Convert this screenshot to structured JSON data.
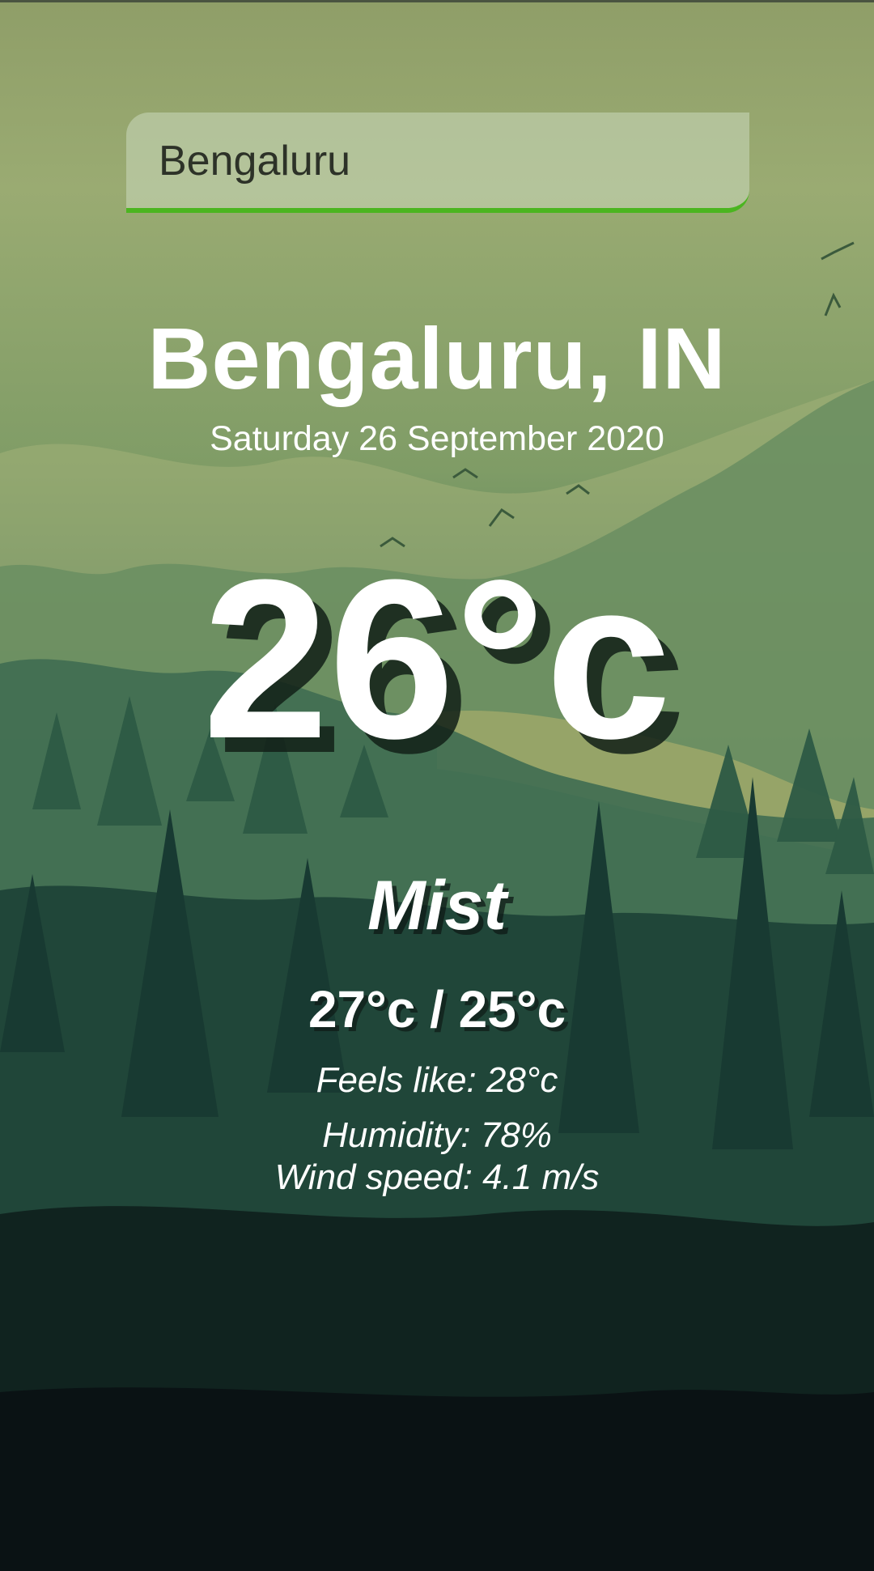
{
  "search": {
    "value": "Bengaluru"
  },
  "weather": {
    "location": "Bengaluru, IN",
    "date": "Saturday 26 September 2020",
    "temperature": "26°c",
    "condition": "Mist",
    "range": "27°c / 25°c",
    "feels_like": "Feels like: 28°c",
    "humidity": "Humidity: 78%",
    "wind_speed": "Wind speed: 4.1 m/s"
  },
  "colors": {
    "accent": "#4bb520",
    "sky_top": "#8f9e68",
    "forest_dark": "#0d1a1c",
    "text": "#ffffff"
  }
}
